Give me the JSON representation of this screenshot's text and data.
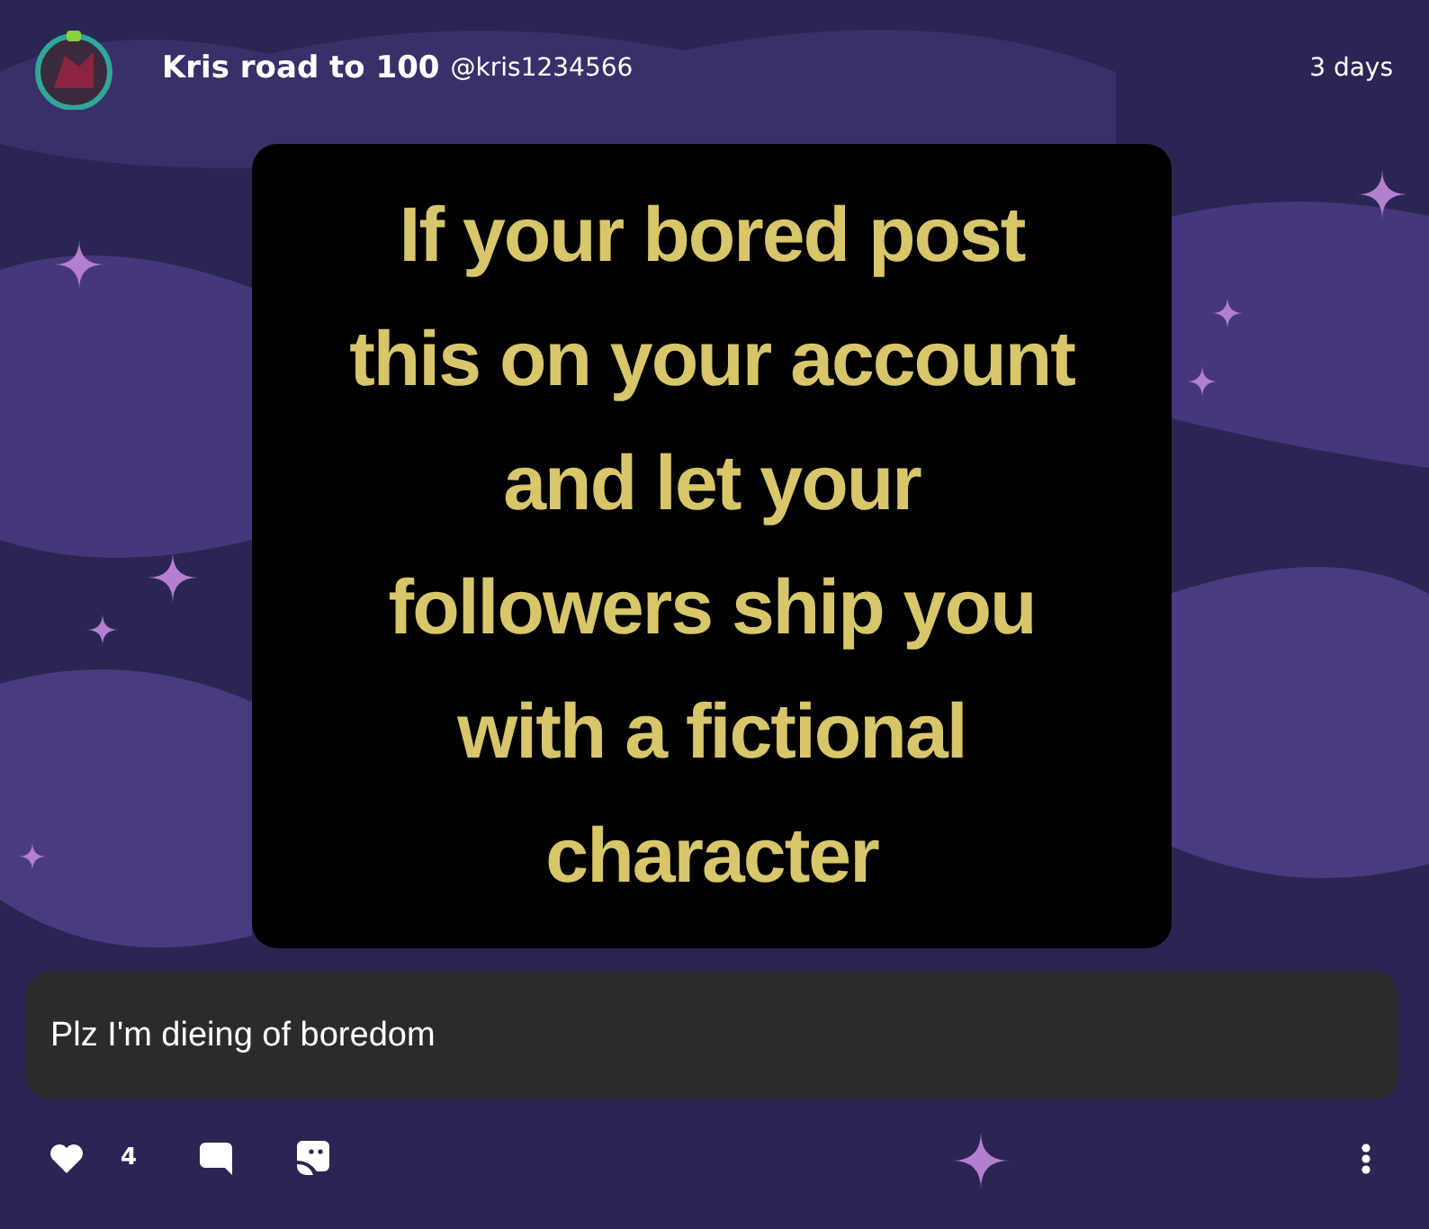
{
  "post": {
    "author": "Kris road to 100",
    "handle": "@kris1234566",
    "time": "3 days",
    "image_text_lines": [
      "If your bored post",
      "this on your account",
      "and let your",
      "followers ship you",
      "with a fictional",
      "character"
    ],
    "caption": "Plz I'm dieing of boredom",
    "likes": "4"
  }
}
